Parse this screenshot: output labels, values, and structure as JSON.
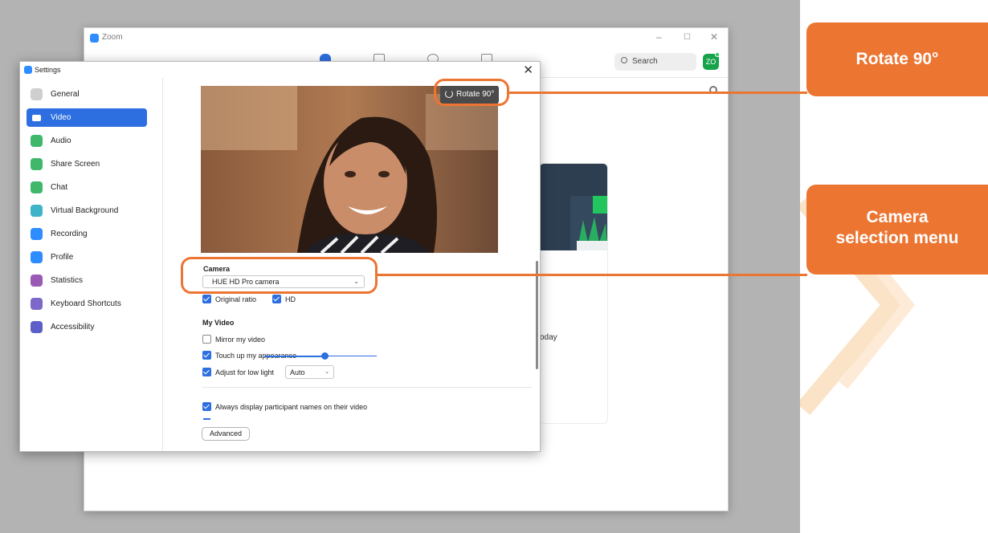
{
  "zoom_window": {
    "title": "Zoom",
    "controls": {
      "minimize": "–",
      "maximize": "☐",
      "close": "✕"
    },
    "search_label": "Search",
    "avatar_initials": "ZO",
    "promo_text": "oday"
  },
  "settings": {
    "title": "Settings",
    "close": "✕",
    "sidebar": [
      {
        "label": "General",
        "icon": "gear-icon",
        "color": "#cfcfcf"
      },
      {
        "label": "Video",
        "icon": "video-camera-icon",
        "color": "#ffffff",
        "active": true
      },
      {
        "label": "Audio",
        "icon": "headphones-icon",
        "color": "#3fb86b"
      },
      {
        "label": "Share Screen",
        "icon": "share-screen-icon",
        "color": "#3fb86b"
      },
      {
        "label": "Chat",
        "icon": "chat-bubble-icon",
        "color": "#3fb86b"
      },
      {
        "label": "Virtual Background",
        "icon": "person-background-icon",
        "color": "#3fb3c9"
      },
      {
        "label": "Recording",
        "icon": "record-icon",
        "color": "#2d8cff"
      },
      {
        "label": "Profile",
        "icon": "profile-icon",
        "color": "#2d8cff"
      },
      {
        "label": "Statistics",
        "icon": "bar-chart-icon",
        "color": "#9b59b6"
      },
      {
        "label": "Keyboard Shortcuts",
        "icon": "keyboard-icon",
        "color": "#7b68c8"
      },
      {
        "label": "Accessibility",
        "icon": "accessibility-icon",
        "color": "#5b5fc7"
      }
    ],
    "video": {
      "rotate_label": "Rotate 90°",
      "camera_heading": "Camera",
      "camera_selected": "HUE HD Pro camera",
      "original_ratio_label": "Original ratio",
      "original_ratio_checked": true,
      "hd_label": "HD",
      "hd_checked": true,
      "my_video_heading": "My Video",
      "mirror_label": "Mirror my video",
      "mirror_checked": false,
      "touch_up_label": "Touch up my appearance",
      "touch_up_checked": true,
      "touch_up_level": 0.55,
      "low_light_label": "Adjust for low light",
      "low_light_checked": true,
      "low_light_value": "Auto",
      "display_names_label": "Always display participant names on their video",
      "display_names_checked": true,
      "advanced_label": "Advanced"
    }
  },
  "callouts": {
    "rotate": "Rotate 90°",
    "camera_line1": "Camera",
    "camera_line2": "selection menu",
    "accent_color": "#ec7532"
  }
}
